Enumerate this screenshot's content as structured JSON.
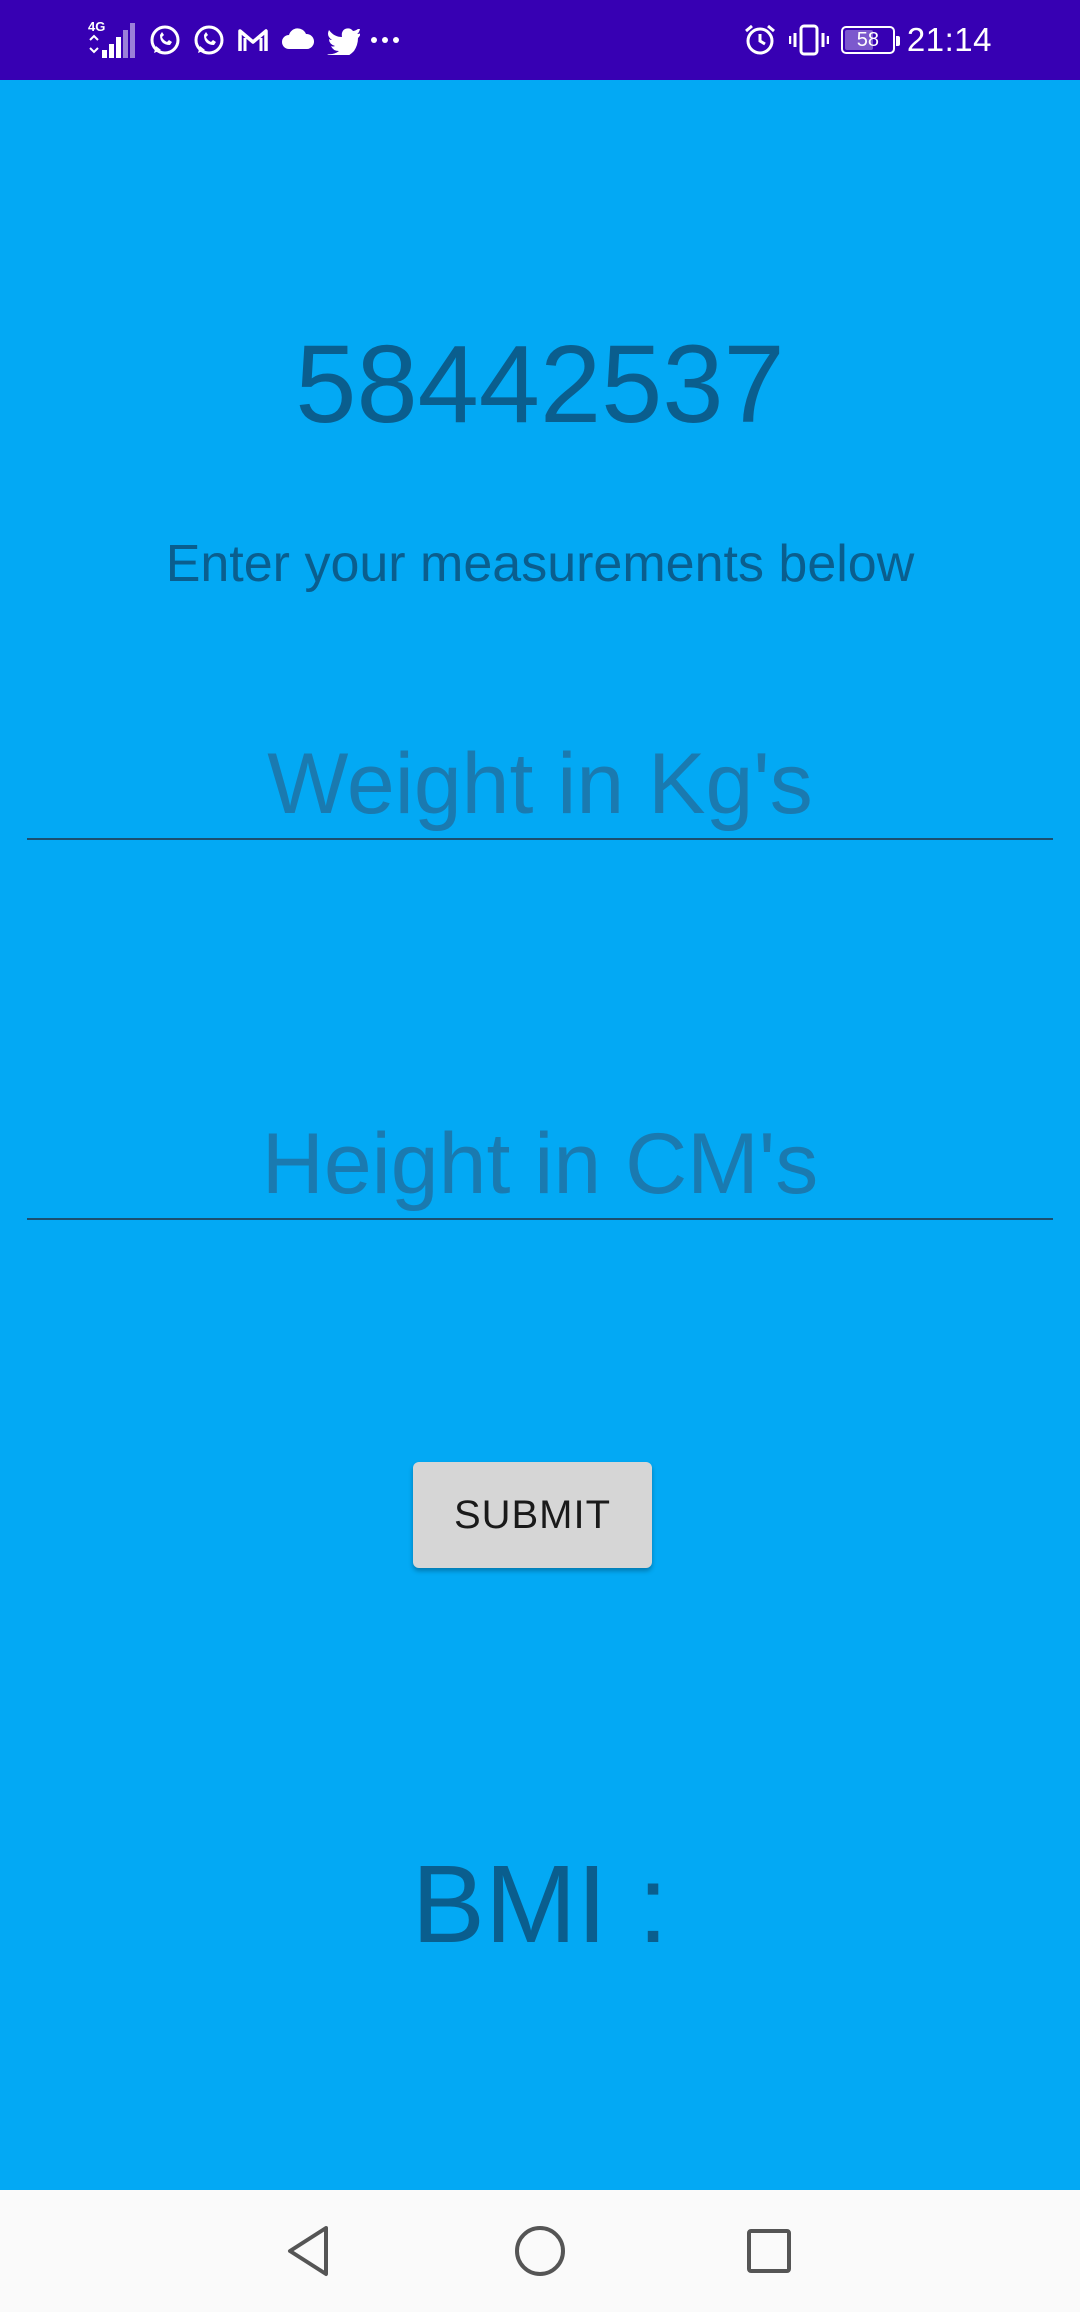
{
  "status_bar": {
    "network": "4G",
    "battery": "58",
    "battery_level": 0.58,
    "time": "21:14",
    "left_icons": [
      "signal-icon",
      "whatsapp-icon",
      "whatsapp-icon",
      "gmail-icon",
      "cloud-icon",
      "twitter-icon",
      "more-icon"
    ],
    "right_icons": [
      "alarm-icon",
      "vibrate-icon",
      "battery-icon"
    ]
  },
  "main": {
    "number": "58442537",
    "subtitle": "Enter your measurements below",
    "weight_placeholder": "Weight in Kg's",
    "height_placeholder": "Height in CM's",
    "submit_label": "SUBMIT",
    "bmi_label": "BMI :"
  },
  "colors": {
    "status_bar_bg": "#3700B3",
    "app_bg": "#03A9F4",
    "text": "#0A5E8E",
    "button_bg": "#D6D6D6",
    "nav_bar_bg": "#FAFAFA"
  },
  "nav_bar": {
    "items": [
      "back-icon",
      "home-icon",
      "recents-icon"
    ]
  }
}
